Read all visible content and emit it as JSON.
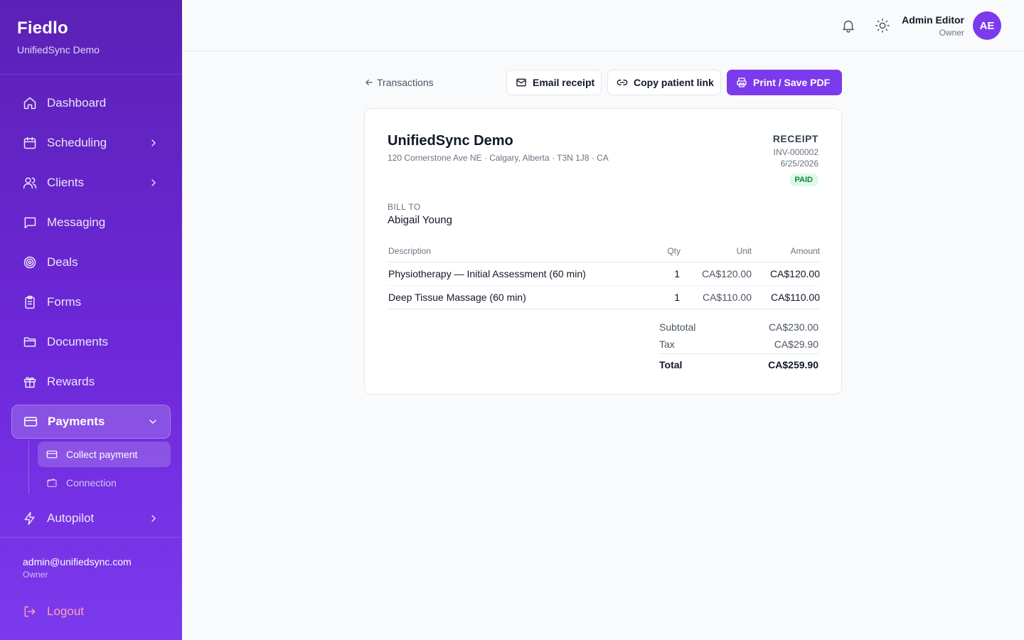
{
  "brand": {
    "name": "Fiedlo",
    "subtitle": "UnifiedSync Demo"
  },
  "sidebar": {
    "items": [
      {
        "label": "Dashboard",
        "icon": "home-icon"
      },
      {
        "label": "Scheduling",
        "icon": "calendar-icon"
      },
      {
        "label": "Clients",
        "icon": "users-icon"
      },
      {
        "label": "Messaging",
        "icon": "message-icon"
      },
      {
        "label": "Deals",
        "icon": "target-icon"
      },
      {
        "label": "Forms",
        "icon": "clipboard-icon"
      },
      {
        "label": "Documents",
        "icon": "folder-icon"
      },
      {
        "label": "Rewards",
        "icon": "gift-icon"
      },
      {
        "label": "Payments",
        "icon": "credit-card-icon"
      },
      {
        "label": "Autopilot",
        "icon": "zap-icon"
      }
    ],
    "payments_sub": [
      {
        "label": "Collect payment",
        "icon": "credit-card-icon"
      },
      {
        "label": "Connection",
        "icon": "wallet-icon"
      }
    ],
    "user": {
      "email": "admin@unifiedsync.com",
      "role": "Owner"
    },
    "logout_label": "Logout"
  },
  "header": {
    "user_name": "Admin Editor",
    "user_role": "Owner",
    "avatar_initials": "AE"
  },
  "toolbar": {
    "back_label": "Transactions",
    "email_label": "Email receipt",
    "copy_label": "Copy patient link",
    "print_label": "Print / Save PDF"
  },
  "receipt": {
    "business_name": "UnifiedSync Demo",
    "address": "120 Cornerstone Ave NE · Calgary, Alberta · T3N 1J8 · CA",
    "title": "RECEIPT",
    "number": "INV-000002",
    "date": "6/25/2026",
    "status": "PAID",
    "bill_to_label": "BILL TO",
    "bill_to_name": "Abigail Young",
    "columns": {
      "description": "Description",
      "qty": "Qty",
      "unit": "Unit",
      "amount": "Amount"
    },
    "items": [
      {
        "description": "Physiotherapy — Initial Assessment (60 min)",
        "qty": "1",
        "unit": "CA$120.00",
        "amount": "CA$120.00"
      },
      {
        "description": "Deep Tissue Massage (60 min)",
        "qty": "1",
        "unit": "CA$110.00",
        "amount": "CA$110.00"
      }
    ],
    "subtotal_label": "Subtotal",
    "subtotal": "CA$230.00",
    "tax_label": "Tax",
    "tax": "CA$29.90",
    "total_label": "Total",
    "total": "CA$259.90"
  },
  "colors": {
    "accent": "#7c3aed",
    "sidebar_top": "#5b21b6",
    "paid_bg": "#dcfce7",
    "paid_text": "#15803d",
    "logout": "#fda4af"
  }
}
